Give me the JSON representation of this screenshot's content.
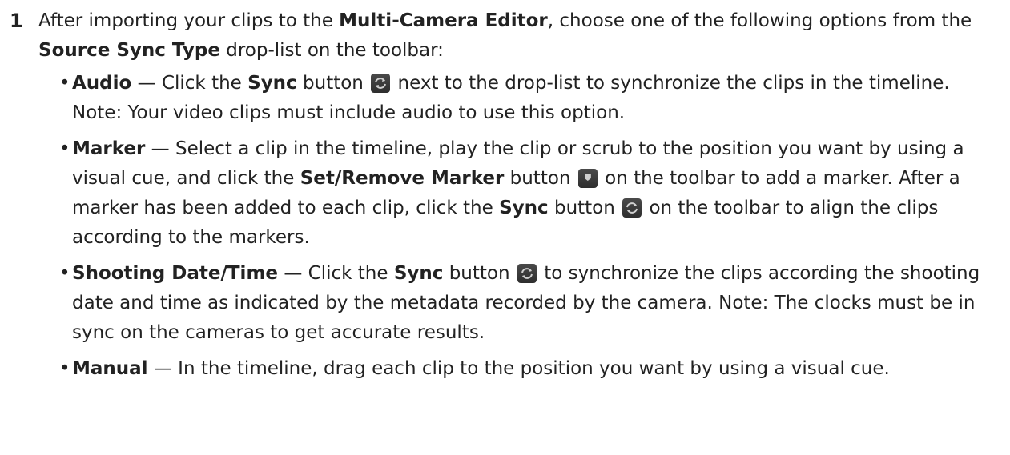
{
  "step": {
    "number": "1",
    "t1": "After importing your clips to the ",
    "b1": "Multi-Camera Editor",
    "t2": ", choose one of the following options from the ",
    "b2": "Source Sync Type",
    "t3": " drop-list on the toolbar:"
  },
  "items": [
    {
      "bullet": "•",
      "title": "Audio",
      "t1": " — Click the ",
      "b1": "Sync",
      "t2": " button",
      "t3": " next to the drop-list to synchronize the clips in the timeline. Note: Your video clips must include audio to use this option."
    },
    {
      "bullet": "•",
      "title": "Marker",
      "t1": " — Select a clip in the timeline, play the clip or scrub to the position you want by using a visual cue, and click the ",
      "b1": "Set/Remove Marker",
      "t2": " button",
      "t3": " on the toolbar to add a marker. After a marker has been added to each clip, click the ",
      "b2": "Sync",
      "t4": " button",
      "t5": " on the toolbar to align the clips according to the markers."
    },
    {
      "bullet": "•",
      "title": "Shooting Date/Time",
      "t1": " — Click the ",
      "b1": "Sync",
      "t2": " button",
      "t3": " to synchronize the clips according the shooting date and time as indicated by the metadata recorded by the camera. Note: The clocks must be in sync on the cameras to get accurate results."
    },
    {
      "bullet": "•",
      "title": "Manual",
      "t1": " — In the timeline, drag each clip to the position you want by using a visual cue."
    }
  ],
  "icons": {
    "sync": "sync-icon",
    "marker": "marker-icon"
  },
  "colors": {
    "text": "#222222",
    "icon_bg": "#3a3a3a",
    "icon_fg": "#d0d0d0"
  }
}
